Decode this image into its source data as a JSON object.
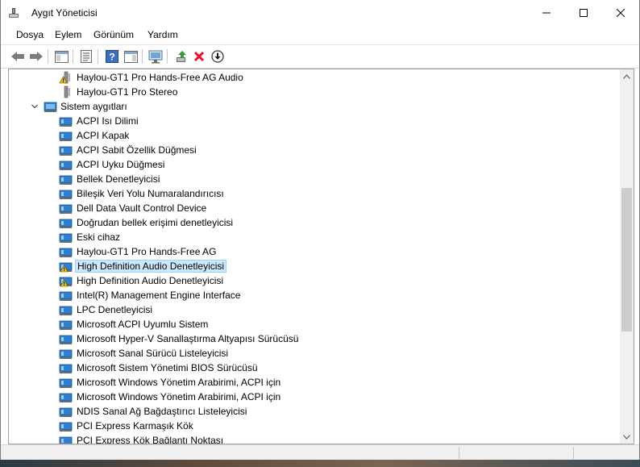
{
  "window": {
    "title": "Aygıt Yöneticisi",
    "icon": "device-manager-icon"
  },
  "menu": [
    {
      "label": "Dosya"
    },
    {
      "label": "Eylem"
    },
    {
      "label": "Görünüm"
    },
    {
      "label": "Yardım"
    }
  ],
  "toolbar": [
    {
      "icon": "back-arrow-icon"
    },
    {
      "icon": "forward-arrow-icon"
    },
    {
      "icon": "show-hide-console-tree-icon"
    },
    {
      "icon": "properties-icon"
    },
    {
      "icon": "help-icon"
    },
    {
      "icon": "action-pane-icon"
    },
    {
      "icon": "monitor-scan-icon"
    },
    {
      "icon": "update-driver-icon"
    },
    {
      "icon": "uninstall-x-icon"
    },
    {
      "icon": "download-circle-icon"
    }
  ],
  "tree": {
    "items": [
      {
        "label": "Haylou-GT1 Pro Hands-Free AG Audio",
        "icon": "audio-device-warning-icon",
        "warning": true
      },
      {
        "label": "Haylou-GT1 Pro Stereo",
        "icon": "audio-device-icon",
        "warning": false
      },
      {
        "label": "Sistem aygıtları",
        "icon": "system-devices-category-icon",
        "category": true,
        "expanded": true
      },
      {
        "label": "ACPI Isı Dilimi",
        "icon": "system-device-icon"
      },
      {
        "label": "ACPI Kapak",
        "icon": "system-device-icon"
      },
      {
        "label": "ACPI Sabit Özellik Düğmesi",
        "icon": "system-device-icon"
      },
      {
        "label": "ACPI Uyku Düğmesi",
        "icon": "system-device-icon"
      },
      {
        "label": "Bellek Denetleyicisi",
        "icon": "system-device-icon"
      },
      {
        "label": "Bileşik Veri Yolu Numaralandırıcısı",
        "icon": "system-device-icon"
      },
      {
        "label": "Dell Data Vault Control Device",
        "icon": "system-device-icon"
      },
      {
        "label": "Doğrudan bellek erişimi denetleyicisi",
        "icon": "system-device-icon"
      },
      {
        "label": "Eski cihaz",
        "icon": "system-device-icon"
      },
      {
        "label": "Haylou-GT1 Pro Hands-Free AG",
        "icon": "system-device-icon"
      },
      {
        "label": "High Definition Audio Denetleyicisi",
        "icon": "system-device-warning-icon",
        "warning": true,
        "selected": true
      },
      {
        "label": "High Definition Audio Denetleyicisi",
        "icon": "system-device-warning-icon",
        "warning": true
      },
      {
        "label": "Intel(R) Management Engine Interface",
        "icon": "system-device-icon"
      },
      {
        "label": "LPC Denetleyicisi",
        "icon": "system-device-icon"
      },
      {
        "label": "Microsoft ACPI Uyumlu Sistem",
        "icon": "system-device-icon"
      },
      {
        "label": "Microsoft Hyper-V Sanallaştırma Altyapısı Sürücüsü",
        "icon": "system-device-icon"
      },
      {
        "label": "Microsoft Sanal Sürücü Listeleyicisi",
        "icon": "system-device-icon"
      },
      {
        "label": "Microsoft Sistem Yönetimi BIOS Sürücüsü",
        "icon": "system-device-icon"
      },
      {
        "label": "Microsoft Windows Yönetim Arabirimi, ACPI için",
        "icon": "system-device-icon"
      },
      {
        "label": "Microsoft Windows Yönetim Arabirimi, ACPI için",
        "icon": "system-device-icon"
      },
      {
        "label": "NDIS Sanal Ağ Bağdaştırıcı Listeleyicisi",
        "icon": "system-device-icon"
      },
      {
        "label": "PCI Express Karmaşık Kök",
        "icon": "system-device-icon"
      },
      {
        "label": "PCI Express Kök Bağlantı Noktası",
        "icon": "system-device-icon"
      }
    ]
  },
  "colors": {
    "selection_bg": "#cce8ff",
    "selection_border": "#99d1ff",
    "warning_yellow": "#f5c400",
    "delete_red": "#e81123",
    "device_blue": "#2f7fd1"
  }
}
